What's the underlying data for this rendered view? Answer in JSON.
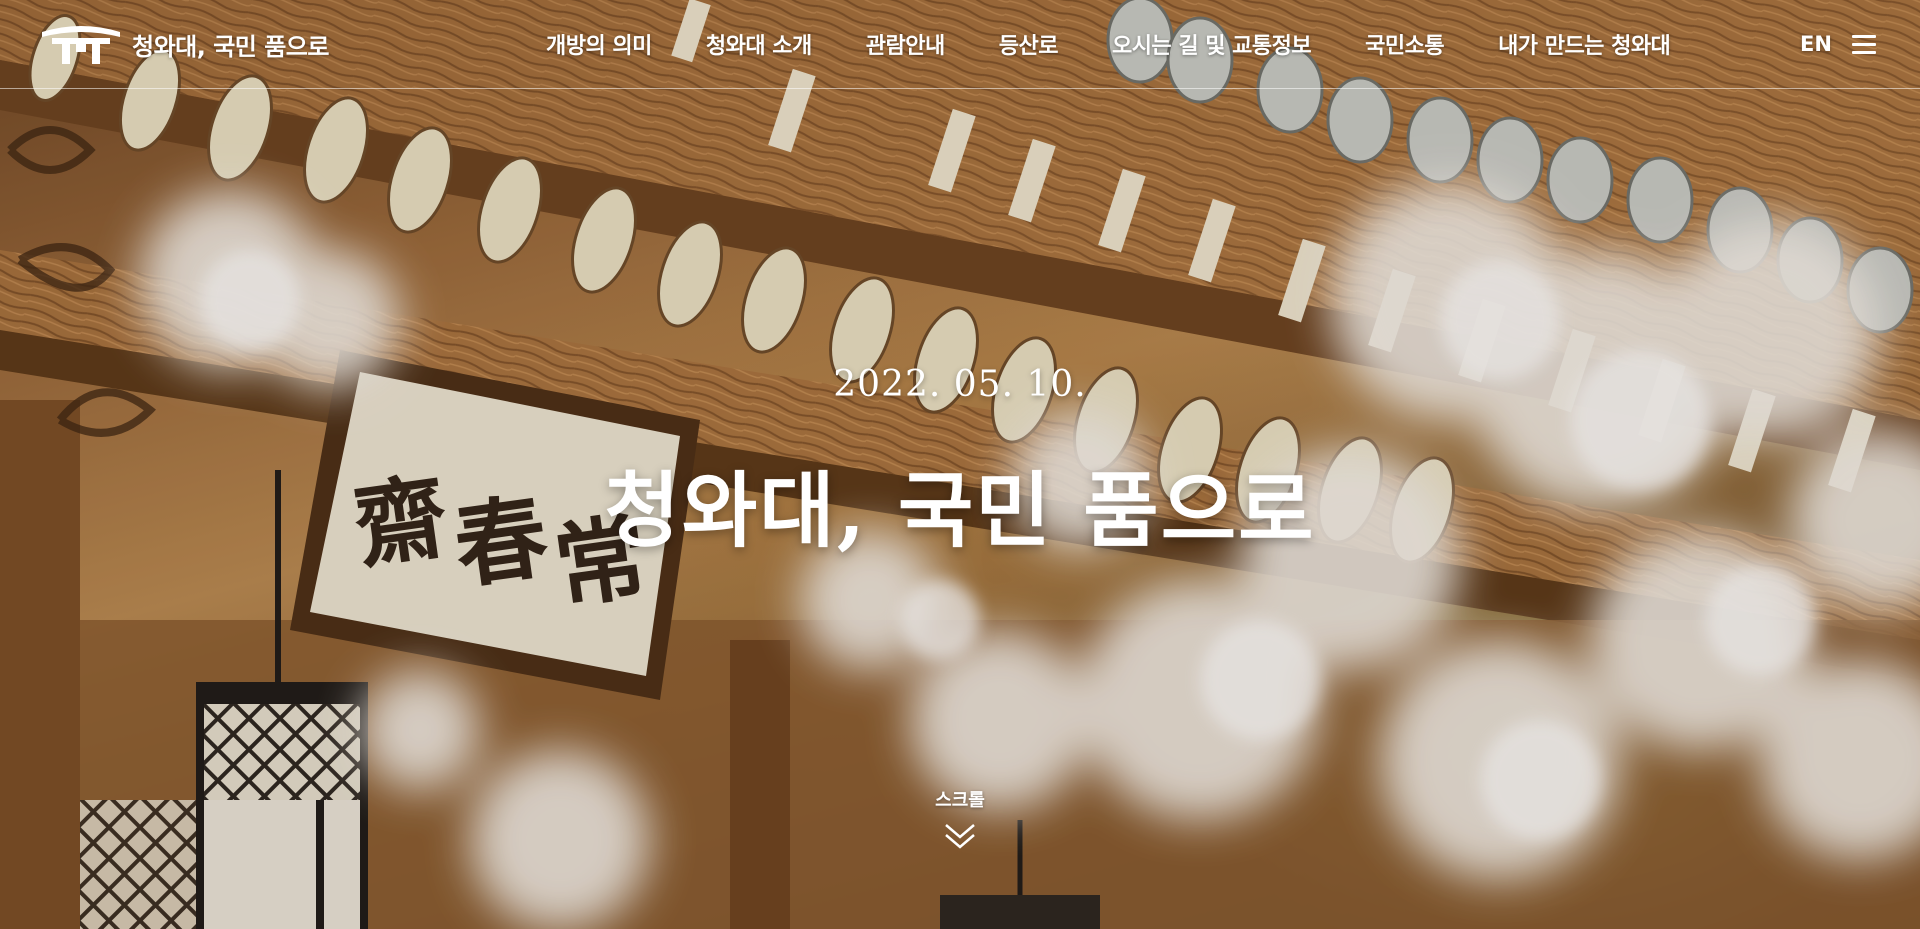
{
  "header": {
    "logo_text": "청와대, 국민 품으로",
    "logo_icon": "pavilion-roof-icon",
    "nav": [
      {
        "label": "개방의 의미"
      },
      {
        "label": "청와대 소개"
      },
      {
        "label": "관람안내"
      },
      {
        "label": "등산로"
      },
      {
        "label": "오시는 길 및 교통정보"
      },
      {
        "label": "국민소통"
      },
      {
        "label": "내가 만드는 청와대"
      }
    ],
    "lang_label": "EN",
    "menu_icon": "hamburger-menu-icon"
  },
  "hero": {
    "date": "2022. 05. 10.",
    "title": "청와대, 국민 품으로"
  },
  "scroll": {
    "label": "스크롤",
    "icon": "double-chevron-down-icon"
  },
  "colors": {
    "text": "#ffffff",
    "wood": "#9a6a3c",
    "blossom": "#f4f1ea"
  }
}
